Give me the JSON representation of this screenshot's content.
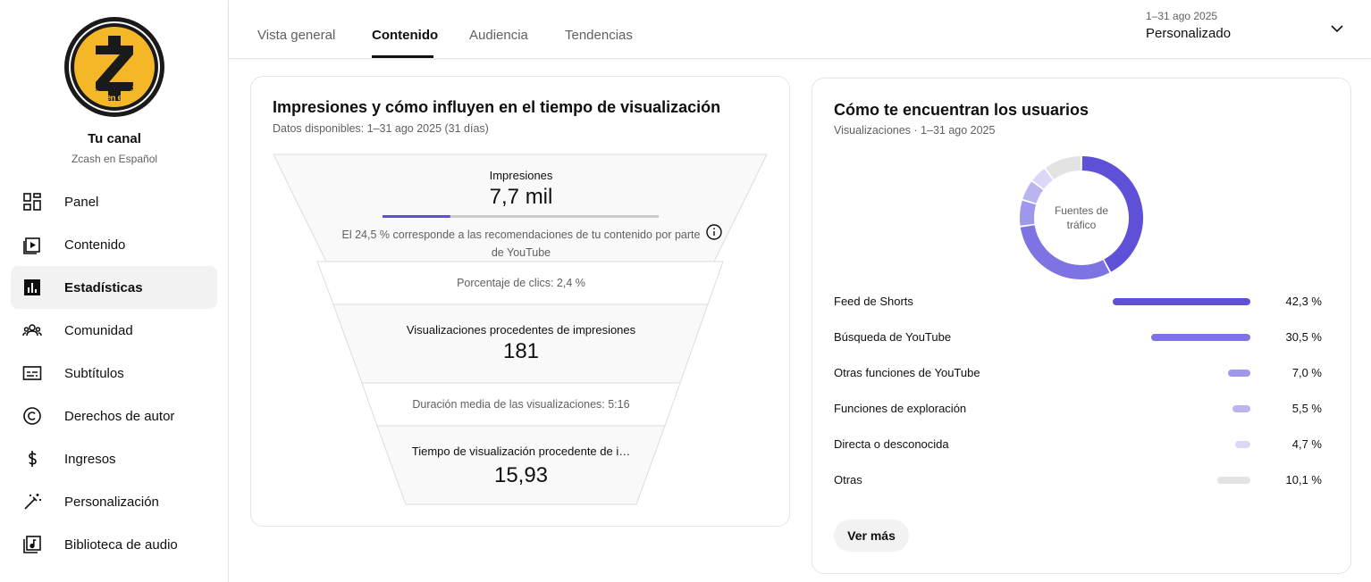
{
  "channel": {
    "title": "Tu canal",
    "name": "Zcash en Español",
    "logo_text": "Zcash en español",
    "logo_letter": "Z",
    "logo_color": "#f4b728"
  },
  "sidebar": {
    "items": [
      {
        "label": "Panel",
        "icon": "dashboard-icon",
        "active": false
      },
      {
        "label": "Contenido",
        "icon": "video-content-icon",
        "active": false
      },
      {
        "label": "Estadísticas",
        "icon": "analytics-icon",
        "active": true
      },
      {
        "label": "Comunidad",
        "icon": "community-icon",
        "active": false
      },
      {
        "label": "Subtítulos",
        "icon": "subtitles-icon",
        "active": false
      },
      {
        "label": "Derechos de autor",
        "icon": "copyright-icon",
        "active": false
      },
      {
        "label": "Ingresos",
        "icon": "dollar-icon",
        "active": false
      },
      {
        "label": "Personalización",
        "icon": "magic-wand-icon",
        "active": false
      },
      {
        "label": "Biblioteca de audio",
        "icon": "audio-library-icon",
        "active": false
      }
    ]
  },
  "header": {
    "tabs": [
      {
        "label": "Vista general",
        "active": false
      },
      {
        "label": "Contenido",
        "active": true
      },
      {
        "label": "Audiencia",
        "active": false
      },
      {
        "label": "Tendencias",
        "active": false
      }
    ],
    "date_range": "1–31 ago 2025",
    "date_mode": "Personalizado"
  },
  "impressions_card": {
    "title": "Impresiones y cómo influyen en el tiempo de visualización",
    "subtitle": "Datos disponibles: 1–31 ago 2025 (31 días)",
    "impressions_label": "Impresiones",
    "impressions_value": "7,7 mil",
    "recommendation_fraction": 0.245,
    "recommendation_note_line1": "El 24,5 % corresponde a las recomendaciones de tu contenido por parte",
    "recommendation_note_line2": "de YouTube",
    "ctr_text": "Porcentaje de clics: 2,4 %",
    "views_label": "Visualizaciones procedentes de impresiones",
    "views_value": "181",
    "avg_duration_text": "Duración media de las visualizaciones: 5:16",
    "watch_time_label": "Tiempo de visualización procedente de i…",
    "watch_time_value": "15,93"
  },
  "traffic_card": {
    "title": "Cómo te encuentran los usuarios",
    "subtitle": "Visualizaciones · 1–31 ago 2025",
    "donut_label_line1": "Fuentes de",
    "donut_label_line2": "tráfico",
    "more_button": "Ver más"
  },
  "chart_data": {
    "type": "pie",
    "title": "Fuentes de tráfico",
    "categories": [
      "Feed de Shorts",
      "Búsqueda de YouTube",
      "Otras funciones de YouTube",
      "Funciones de exploración",
      "Directa o desconocida",
      "Otras"
    ],
    "values": [
      42.3,
      30.5,
      7.0,
      5.5,
      4.7,
      10.1
    ],
    "value_labels": [
      "42,3 %",
      "30,5 %",
      "7,0 %",
      "5,5 %",
      "4,7 %",
      "10,1 %"
    ],
    "colors": [
      "#5e51d8",
      "#7e73e2",
      "#9f97eb",
      "#bab4f1",
      "#dad7f8",
      "#e3e3e3"
    ]
  }
}
